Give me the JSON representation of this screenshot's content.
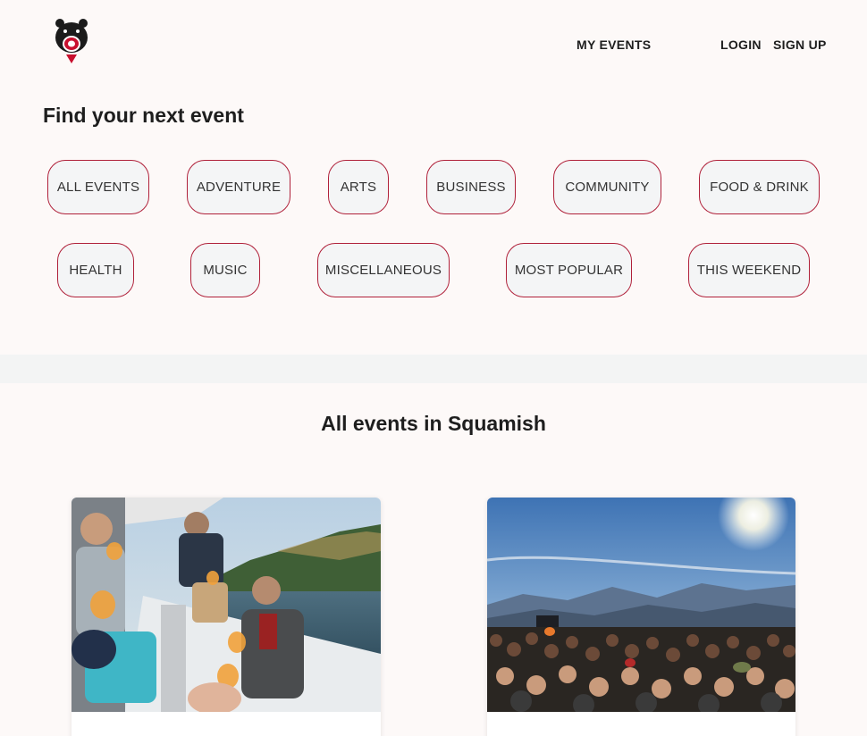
{
  "header": {
    "logo_icon": "bear-logo-icon",
    "nav": {
      "my_events": "MY EVENTS",
      "login": "LOGIN",
      "sign_up": "SIGN UP"
    }
  },
  "filters": {
    "title": "Find your next event",
    "categories": [
      "ALL EVENTS",
      "ADVENTURE",
      "ARTS",
      "BUSINESS",
      "COMMUNITY",
      "FOOD & DRINK",
      "HEALTH",
      "MUSIC",
      "MISCELLANEOUS",
      "MOST POPULAR",
      "THIS WEEKEND"
    ]
  },
  "events": {
    "title": "All events in Squamish",
    "cards": [
      {
        "image": "sailboat-drinks-photo"
      },
      {
        "image": "mountain-festival-crowd-photo"
      }
    ]
  },
  "colors": {
    "background": "#fdf9f8",
    "chip_border": "#b0213a",
    "chip_fill": "#f4f5f6",
    "brand_red": "#c8102e"
  }
}
